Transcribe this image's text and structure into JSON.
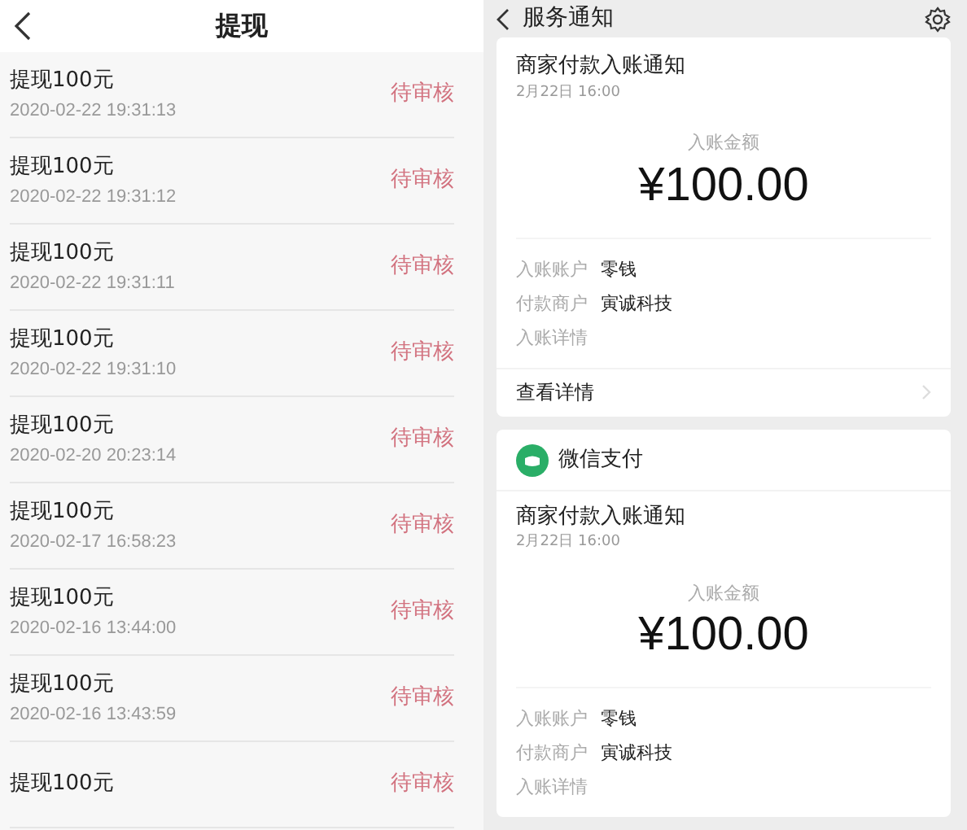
{
  "withdrawals": {
    "title": "提现",
    "records": [
      {
        "title": "提现100元",
        "time": "2020-02-22 19:31:13",
        "status": "待审核"
      },
      {
        "title": "提现100元",
        "time": "2020-02-22 19:31:12",
        "status": "待审核"
      },
      {
        "title": "提现100元",
        "time": "2020-02-22 19:31:11",
        "status": "待审核"
      },
      {
        "title": "提现100元",
        "time": "2020-02-22 19:31:10",
        "status": "待审核"
      },
      {
        "title": "提现100元",
        "time": "2020-02-20 20:23:14",
        "status": "待审核"
      },
      {
        "title": "提现100元",
        "time": "2020-02-17 16:58:23",
        "status": "待审核"
      },
      {
        "title": "提现100元",
        "time": "2020-02-16 13:44:00",
        "status": "待审核"
      },
      {
        "title": "提现100元",
        "time": "2020-02-16 13:43:59",
        "status": "待审核"
      },
      {
        "title": "提现100元",
        "status": "待审核"
      }
    ]
  },
  "notifications": {
    "title": "服务通知",
    "cards": [
      {
        "title": "商家付款入账通知",
        "date": "2月22日 16:00",
        "amount_label": "入账金额",
        "amount": "¥100.00",
        "fields": [
          {
            "label": "入账账户",
            "value": "零钱"
          },
          {
            "label": "付款商户",
            "value": "寅诚科技"
          },
          {
            "label": "入账详情"
          }
        ],
        "link": "查看详情"
      },
      {
        "source": "微信支付",
        "title": "商家付款入账通知",
        "date": "2月22日 16:00",
        "amount_label": "入账金额",
        "amount": "¥100.00",
        "fields": [
          {
            "label": "入账账户",
            "value": "零钱"
          },
          {
            "label": "付款商户",
            "value": "寅诚科技"
          },
          {
            "label": "入账详情"
          }
        ]
      }
    ]
  }
}
